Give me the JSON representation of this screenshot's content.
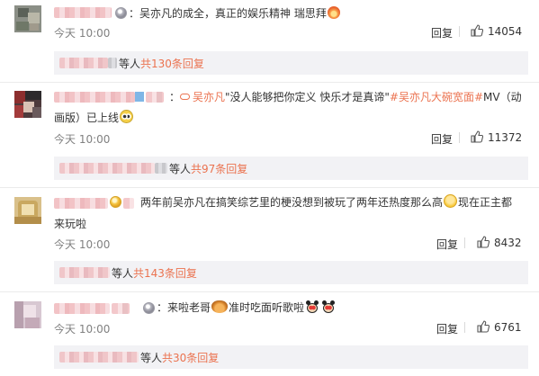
{
  "comments": [
    {
      "segments": [
        {
          "text": "：吴亦凡的成全，真正的娱乐精神 瑞思拜",
          "style": "plain"
        }
      ],
      "emoji_after": "fire-emoji",
      "time": "今天 10:00",
      "reply_label": "回复",
      "likes": "14054",
      "replies_suffix": "等人",
      "replies_count": "共130条回复"
    },
    {
      "link_label": "吴亦凡",
      "text_after_link": "\"没人能够把你定义 快乐才是真谛\"",
      "hashtag": "#吴亦凡大碗宽面#",
      "text_end": "MV（动",
      "line2": "画版）已上线",
      "emoji_after": "peek-eyes-emoji",
      "time": "今天 10:00",
      "reply_label": "回复",
      "likes": "11372",
      "replies_suffix": "等人",
      "replies_count": "共97条回复"
    },
    {
      "line1": "两年前吴亦凡在搞笑综艺里的梗没想到被玩了两年还热度那么高",
      "line1_after": "现在正主都",
      "line2": "来玩啦",
      "emoji_after": "laugh-cry-emoji",
      "time": "今天 10:00",
      "reply_label": "回复",
      "likes": "8432",
      "replies_suffix": "等人",
      "replies_count": "共143条回复"
    },
    {
      "part1": "：来啦老哥",
      "part2": "准时吃面听歌啦",
      "emoji_mid": "noodle-bowl-emoji",
      "emoji_end": "mickey-emoji",
      "time": "今天 10:00",
      "reply_label": "回复",
      "likes": "6761",
      "replies_suffix": "等人",
      "replies_count": "共30条回复"
    }
  ],
  "colors": {
    "link": "#eb7350",
    "meta": "#808080",
    "reply_bg": "#f2f2f5"
  }
}
